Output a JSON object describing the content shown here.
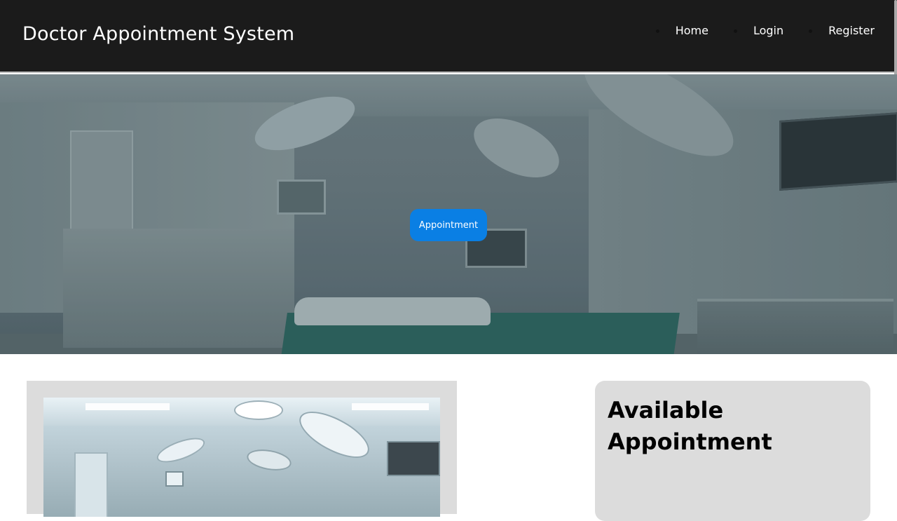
{
  "header": {
    "title": "Doctor Appointment System",
    "nav": [
      {
        "label": "Home"
      },
      {
        "label": "Login"
      },
      {
        "label": "Register"
      }
    ]
  },
  "hero": {
    "button_label": "Appointment"
  },
  "available_card": {
    "heading": "Available Appointment"
  },
  "colors": {
    "header_bg": "#1b1b1b",
    "button_bg": "#0a7fe4",
    "card_bg": "#dcdcdc"
  }
}
